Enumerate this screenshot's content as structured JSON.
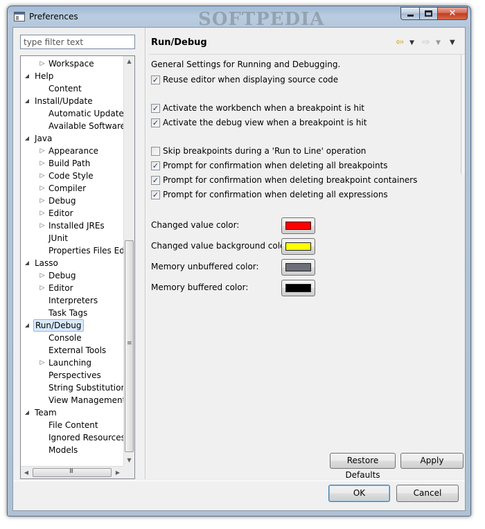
{
  "window": {
    "title": "Preferences",
    "watermark": "SOFTPEDIA"
  },
  "filter": {
    "placeholder": "type filter text",
    "value": ""
  },
  "tree": [
    {
      "label": "Workspace",
      "level": 1,
      "expander": "closed"
    },
    {
      "label": "Help",
      "level": 0,
      "expander": "open"
    },
    {
      "label": "Content",
      "level": 1,
      "expander": "none"
    },
    {
      "label": "Install/Update",
      "level": 0,
      "expander": "open"
    },
    {
      "label": "Automatic Updates",
      "level": 1,
      "expander": "none"
    },
    {
      "label": "Available Software Sites",
      "level": 1,
      "expander": "none"
    },
    {
      "label": "Java",
      "level": 0,
      "expander": "open"
    },
    {
      "label": "Appearance",
      "level": 1,
      "expander": "closed"
    },
    {
      "label": "Build Path",
      "level": 1,
      "expander": "closed"
    },
    {
      "label": "Code Style",
      "level": 1,
      "expander": "closed"
    },
    {
      "label": "Compiler",
      "level": 1,
      "expander": "closed"
    },
    {
      "label": "Debug",
      "level": 1,
      "expander": "closed"
    },
    {
      "label": "Editor",
      "level": 1,
      "expander": "closed"
    },
    {
      "label": "Installed JREs",
      "level": 1,
      "expander": "closed"
    },
    {
      "label": "JUnit",
      "level": 1,
      "expander": "none"
    },
    {
      "label": "Properties Files Editor",
      "level": 1,
      "expander": "none"
    },
    {
      "label": "Lasso",
      "level": 0,
      "expander": "open"
    },
    {
      "label": "Debug",
      "level": 1,
      "expander": "closed"
    },
    {
      "label": "Editor",
      "level": 1,
      "expander": "closed"
    },
    {
      "label": "Interpreters",
      "level": 1,
      "expander": "none"
    },
    {
      "label": "Task Tags",
      "level": 1,
      "expander": "none"
    },
    {
      "label": "Run/Debug",
      "level": 0,
      "expander": "open",
      "selected": true
    },
    {
      "label": "Console",
      "level": 1,
      "expander": "none"
    },
    {
      "label": "External Tools",
      "level": 1,
      "expander": "none"
    },
    {
      "label": "Launching",
      "level": 1,
      "expander": "closed"
    },
    {
      "label": "Perspectives",
      "level": 1,
      "expander": "none"
    },
    {
      "label": "String Substitution",
      "level": 1,
      "expander": "none"
    },
    {
      "label": "View Management",
      "level": 1,
      "expander": "none"
    },
    {
      "label": "Team",
      "level": 0,
      "expander": "open"
    },
    {
      "label": "File Content",
      "level": 1,
      "expander": "none"
    },
    {
      "label": "Ignored Resources",
      "level": 1,
      "expander": "none"
    },
    {
      "label": "Models",
      "level": 1,
      "expander": "none"
    }
  ],
  "page": {
    "title": "Run/Debug",
    "description": "General Settings for Running and Debugging.",
    "checkboxes": {
      "reuse_editor": {
        "label": "Reuse editor when displaying source code",
        "checked": true
      },
      "activate_workbench": {
        "label": "Activate the workbench when a breakpoint is hit",
        "checked": true
      },
      "activate_debug_view": {
        "label": "Activate the debug view when a breakpoint is hit",
        "checked": true
      },
      "skip_breakpoints": {
        "label": "Skip breakpoints during a 'Run to Line' operation",
        "checked": false
      },
      "confirm_delete_breakpoints": {
        "label": "Prompt for confirmation when deleting all breakpoints",
        "checked": true
      },
      "confirm_delete_containers": {
        "label": "Prompt for confirmation when deleting breakpoint containers",
        "checked": true
      },
      "confirm_delete_expressions": {
        "label": "Prompt for confirmation when deleting all expressions",
        "checked": true
      }
    },
    "colors": {
      "changed_value": {
        "label": "Changed value color:",
        "color": "#ff0000"
      },
      "changed_background": {
        "label": "Changed value background color:",
        "color": "#ffff00"
      },
      "memory_unbuffered": {
        "label": "Memory unbuffered color:",
        "color": "#6e7079"
      },
      "memory_buffered": {
        "label": "Memory buffered color:",
        "color": "#000000"
      }
    },
    "restore_defaults": "Restore Defaults",
    "apply": "Apply"
  },
  "dialog": {
    "ok": "OK",
    "cancel": "Cancel"
  },
  "scrollbar": {
    "h_grip": "III",
    "v_grip": "≡"
  }
}
